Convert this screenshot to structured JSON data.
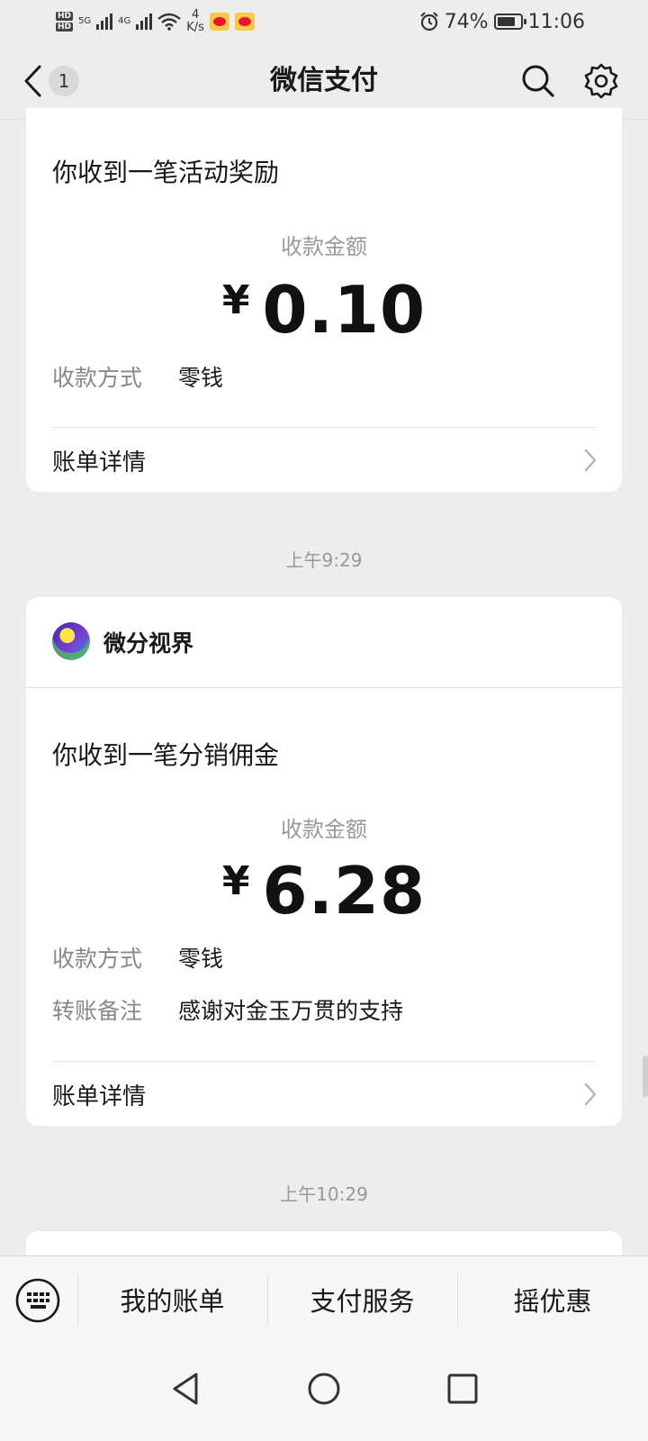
{
  "status_bar": {
    "net_speed_value": "4",
    "net_speed_unit": "K/s",
    "battery": "74%",
    "time": "11:06",
    "signal_1_label": "5G",
    "signal_2_label": "4G"
  },
  "nav": {
    "title": "微信支付",
    "back_badge": "1",
    "search_icon": "search-icon",
    "settings_icon": "gear-icon"
  },
  "cards": [
    {
      "title": "你收到一笔活动奖励",
      "amount_label": "收款金额",
      "currency": "¥",
      "amount": "0.10",
      "rows": [
        {
          "label": "收款方式",
          "value": "零钱"
        }
      ],
      "detail_label": "账单详情"
    },
    {
      "merchant": "微分视界",
      "title": "你收到一笔分销佣金",
      "amount_label": "收款金额",
      "currency": "¥",
      "amount": "6.28",
      "rows": [
        {
          "label": "收款方式",
          "value": "零钱"
        },
        {
          "label": "转账备注",
          "value": "感谢对金玉万贯的支持"
        }
      ],
      "detail_label": "账单详情"
    }
  ],
  "times": [
    "上午9:29",
    "上午10:29"
  ],
  "bottom_menu": {
    "items": [
      "我的账单",
      "支付服务",
      "摇优惠"
    ],
    "keyboard_icon": "keyboard-icon"
  },
  "system_nav": [
    "back-triangle-icon",
    "home-circle-icon",
    "recents-square-icon"
  ]
}
